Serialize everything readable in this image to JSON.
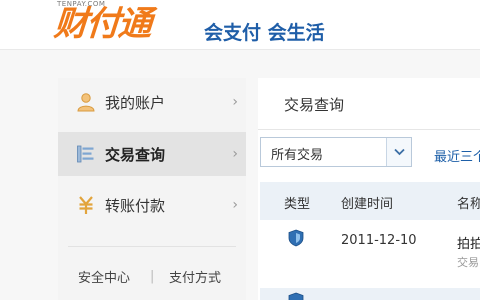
{
  "header": {
    "logo_text": "财付通",
    "logo_domain": "TENPAY.COM",
    "slogan": "会支付 会生活"
  },
  "sidebar": {
    "items": [
      {
        "label": "我的账户",
        "icon": "user-icon"
      },
      {
        "label": "交易查询",
        "icon": "list-icon",
        "active": true
      },
      {
        "label": "转账付款",
        "icon": "yuan-icon"
      }
    ],
    "chevron": "›",
    "links": [
      {
        "label": "安全中心"
      },
      {
        "label": "支付方式"
      }
    ],
    "link_separator": "|"
  },
  "main": {
    "title": "交易查询",
    "filter": {
      "selected": "所有交易",
      "range_link": "最近三个"
    },
    "table": {
      "headers": [
        "类型",
        "创建时间",
        "名称"
      ],
      "rows": [
        {
          "icon": "shield-icon",
          "date": "2011-12-10",
          "name": "拍拍",
          "sub": "交易"
        }
      ]
    }
  },
  "colors": {
    "brand_orange": "#f07a1a",
    "brand_blue": "#1f5ea8",
    "link_blue": "#1d5fa8",
    "table_header_bg": "#ebf1f7"
  }
}
